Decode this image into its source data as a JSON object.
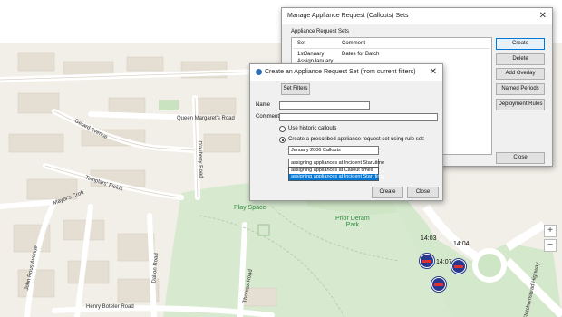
{
  "manage_dialog": {
    "title": "Manage Appliance Request (Callouts) Sets",
    "section_label": "Appliance Request Sets",
    "columns": [
      "Set",
      "Comment"
    ],
    "rows": [
      {
        "set": "1stJanuary",
        "comment": "Dates for Batch"
      },
      {
        "set": "AssignJanuary",
        "comment": ""
      }
    ],
    "buttons": {
      "create": "Create",
      "delete": "Delete",
      "add_overlay": "Add Overlay",
      "named_periods": "Named Periods",
      "deployment_rules": "Deployment Rules",
      "close": "Close"
    }
  },
  "create_dialog": {
    "title": "Create an Appliance Request Set (from current filters)",
    "set_filters": "Set Filters",
    "name_label": "Name",
    "comment_label": "Comment",
    "radio_historic": "Use historic callouts",
    "radio_prescribed": "Create a prescribed appliance request set using rule set:",
    "rule_set_value": "January 2006 Callouts",
    "assign_value": "assigning appliances at Incident Start time",
    "assign_options": [
      "assigning appliances at Callout times",
      "assigning appliances at Incident Start time"
    ],
    "create_button": "Create",
    "close_button": "Close"
  },
  "map": {
    "labels": {
      "queen_margarets_road": "Queen Margaret's Road",
      "gerard_avenue": "Gerard Avenue",
      "templars_fields": "Templars' Fields",
      "mayors_croft": "Mayor's Croft",
      "john_rous_avenue": "John Rous Avenue",
      "henry_boteler_road": "Henry Boteler Road",
      "dalton_road": "Dalton Road",
      "daubeny_road": "D'aubeny Road",
      "thomas_road": "Thomas Road",
      "fletchamstead": "Fletchamstead Highway",
      "play_space": "Play Space",
      "prior_deram_park": "Prior Deram\nPark"
    },
    "times": [
      "14:03",
      "14:04",
      "14:07"
    ]
  }
}
